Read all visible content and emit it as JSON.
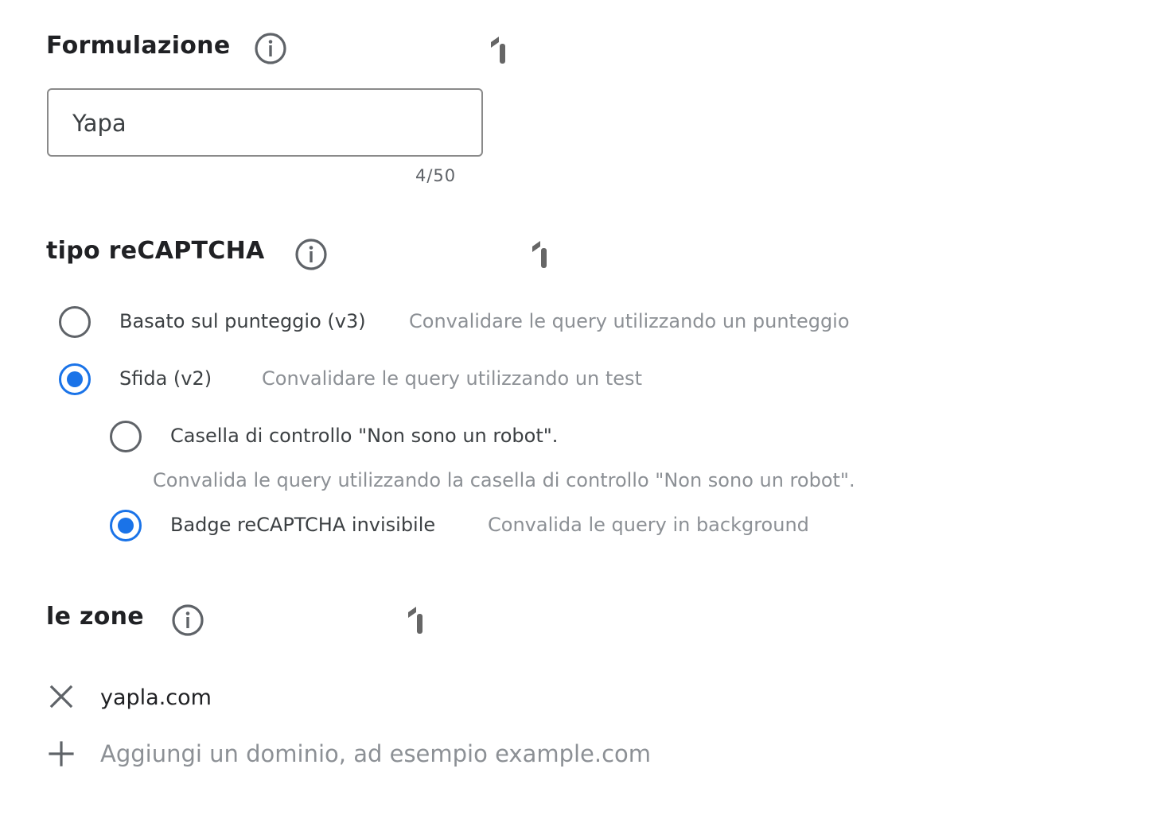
{
  "label_section": {
    "title": "Formulazione",
    "input_value": "Yapa",
    "char_counter": "4/50"
  },
  "recaptcha_section": {
    "title": "tipo reCAPTCHA",
    "options": [
      {
        "label": "Basato sul punteggio (v3)",
        "description": "Convalidare le query utilizzando un punteggio",
        "selected": false
      },
      {
        "label": "Sfida (v2)",
        "description": "Convalidare le query utilizzando un test",
        "selected": true
      }
    ],
    "sub_options": [
      {
        "label": "Casella di controllo \"Non sono un robot\".",
        "description": "Convalida le query utilizzando la casella di controllo \"Non sono un robot\".",
        "selected": false
      },
      {
        "label": "Badge reCAPTCHA invisibile",
        "description": "Convalida le query in background",
        "selected": true
      }
    ]
  },
  "domains_section": {
    "title": "le zone",
    "domains": [
      "yapla.com"
    ],
    "add_placeholder": "Aggiungi un dominio, ad esempio example.com"
  },
  "icons": {
    "info": "info-circle-icon",
    "badge": "one-badge-icon",
    "remove": "close-icon",
    "add": "plus-icon"
  },
  "colors": {
    "accent": "#1a73e8",
    "text_primary": "#202124",
    "text_secondary": "#8c9095",
    "icon_grey": "#5f6368"
  }
}
